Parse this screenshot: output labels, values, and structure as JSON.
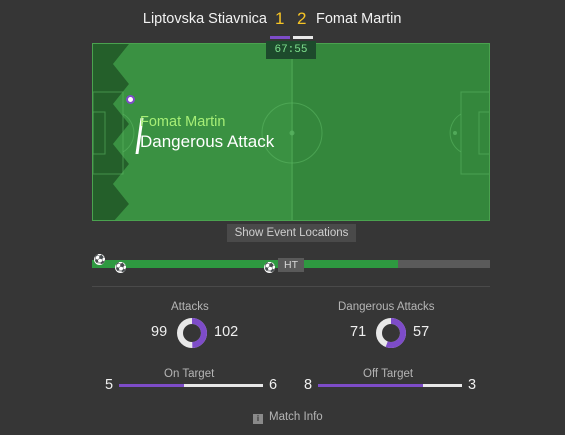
{
  "match": {
    "home_team": "Liptovska Stiavnica",
    "away_team": "Fomat Martin",
    "home_score": "1",
    "away_score": "2",
    "clock": "67:55"
  },
  "event": {
    "team": "Fomat Martin",
    "type": "Dangerous Attack"
  },
  "controls": {
    "show_locations_label": "Show Event Locations",
    "ht_label": "HT",
    "match_info_label": "Match Info",
    "match_info_icon": "info-icon",
    "goal_icon": "soccer-ball-icon"
  },
  "timeline": {
    "progress_fraction": 0.77
  },
  "stats": {
    "attacks": {
      "title": "Attacks",
      "home": "99",
      "away": "102"
    },
    "dangerous_attacks": {
      "title": "Dangerous Attacks",
      "home": "71",
      "away": "57"
    },
    "on_target": {
      "title": "On Target",
      "home": "5",
      "away": "6"
    },
    "off_target": {
      "title": "Off Target",
      "home": "8",
      "away": "3"
    }
  },
  "colors": {
    "home": "#7d4cc8",
    "away": "#e8e8e8",
    "pitch_dark": "#2e7a35",
    "pitch_light": "#3c9443",
    "score": "#f6c425",
    "timeline": "#2e9940"
  }
}
